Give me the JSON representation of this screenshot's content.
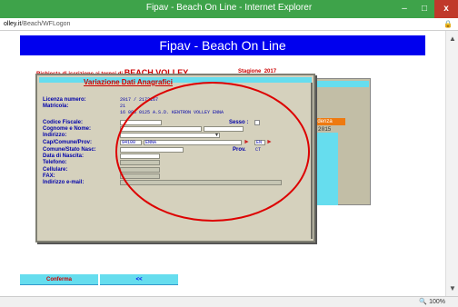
{
  "window": {
    "title": "Fipav - Beach On Line - Internet Explorer",
    "minimize": "–",
    "maximize": "□",
    "close": "x"
  },
  "address": {
    "prefix": "olley.it",
    "path": "/Beach/WFLogon",
    "lock": "🔒"
  },
  "page": {
    "header": "Fipav - Beach On Line",
    "request_small": "Richiesta di iscrizione ai tornei di ",
    "request_big": "BEACH VOLLEY",
    "stagione_label": "Stagione",
    "stagione_value": "2017",
    "section_small": "Variazione ",
    "section_big": "Dati Anagrafici",
    "residenza_label": "idenza",
    "residenza_year": "2015"
  },
  "form": {
    "licenza_label": "Licenza numero:",
    "licenza_value": "2017 / 2172167",
    "matricola_label": "Matricola:",
    "matricola_value": "21",
    "club_value": "16 086 0125 A.S.D. KENTRON VOLLEY ENNA",
    "codice_fiscale_label": "Codice Fiscale:",
    "sesso_label": "Sesso :",
    "cognome_label": "Cognome e Nome:",
    "indirizzo_label": "Indirizzo:",
    "cap_label": "Cap/Comune/Prov:",
    "cap_value": "94100",
    "comune_value": "ENNA",
    "prov_value": "EN",
    "comune_stato_label": "Comune/Stato Nasc:",
    "prov_label": "Prov.",
    "prov_nasc_value": "CT",
    "data_nascita_label": "Data di Nascita:",
    "telefono_label": "Telefono:",
    "cellulare_label": "Cellulare:",
    "fax_label": "FAX:",
    "email_label": "Indirizzo e-mail:"
  },
  "buttons": {
    "conferma": "Conferma",
    "back": "<<"
  },
  "status": {
    "zoom": "🔍 100%"
  },
  "colors": {
    "titlebar": "#3ea34a",
    "header": "#0000ee",
    "accent_cyan": "#66ddee",
    "panel": "#d5d1bd",
    "annotation": "#dd0000"
  }
}
